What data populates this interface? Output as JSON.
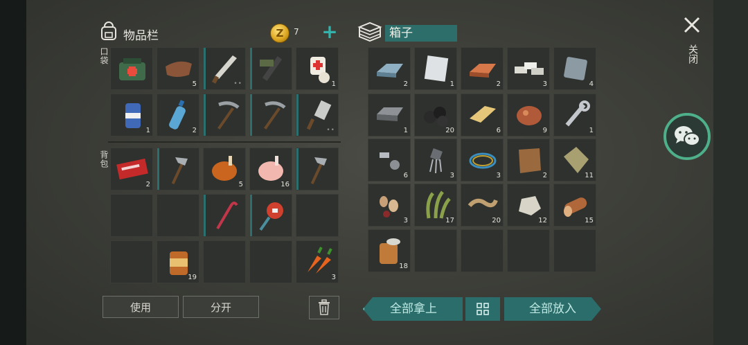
{
  "inventory": {
    "title": "物品栏",
    "coins": "7",
    "coin_symbol": "Z",
    "pocket_label": "口袋",
    "backpack_label": "背包",
    "pocket_slots": [
      {
        "icon": "first-aid-bag-icon",
        "count": ""
      },
      {
        "icon": "leather-icon",
        "count": "5"
      },
      {
        "icon": "machete-icon",
        "count": "",
        "durability": "••"
      },
      {
        "icon": "crossbow-icon",
        "count": ""
      },
      {
        "icon": "bandage-icon",
        "count": "1"
      },
      {
        "icon": "beer-can-icon",
        "count": "1"
      },
      {
        "icon": "water-bottle-icon",
        "count": "2"
      },
      {
        "icon": "pickaxe-icon",
        "count": ""
      },
      {
        "icon": "pickaxe-icon",
        "count": ""
      },
      {
        "icon": "cleaver-icon",
        "count": "",
        "durability": "••"
      }
    ],
    "backpack_slots": [
      {
        "icon": "coupon-icon",
        "count": "2"
      },
      {
        "icon": "hatchet-icon",
        "count": ""
      },
      {
        "icon": "roast-chicken-icon",
        "count": "5"
      },
      {
        "icon": "raw-chicken-icon",
        "count": "16"
      },
      {
        "icon": "hatchet-icon",
        "count": ""
      },
      {
        "icon": "",
        "count": ""
      },
      {
        "icon": "",
        "count": ""
      },
      {
        "icon": "crowbar-icon",
        "count": ""
      },
      {
        "icon": "stop-sign-icon",
        "count": ""
      },
      {
        "icon": "",
        "count": ""
      },
      {
        "icon": "",
        "count": ""
      },
      {
        "icon": "canned-food-icon",
        "count": "19"
      },
      {
        "icon": "",
        "count": ""
      },
      {
        "icon": "",
        "count": ""
      },
      {
        "icon": "carrot-icon",
        "count": "3"
      }
    ],
    "use_label": "使用",
    "split_label": "分开"
  },
  "box": {
    "title": "箱子",
    "slots": [
      {
        "icon": "iron-ingot-icon",
        "count": "2"
      },
      {
        "icon": "aluminum-sheet-icon",
        "count": "1"
      },
      {
        "icon": "copper-ingot-icon",
        "count": "2"
      },
      {
        "icon": "silver-bars-icon",
        "count": "3"
      },
      {
        "icon": "steel-plate-icon",
        "count": "4"
      },
      {
        "icon": "iron-brick-icon",
        "count": "1"
      },
      {
        "icon": "coal-icon",
        "count": "20"
      },
      {
        "icon": "gold-ingot-icon",
        "count": "6"
      },
      {
        "icon": "copper-ore-icon",
        "count": "9"
      },
      {
        "icon": "wrench-icon",
        "count": "1"
      },
      {
        "icon": "bolts-icon",
        "count": "6"
      },
      {
        "icon": "transistor-icon",
        "count": "3"
      },
      {
        "icon": "wire-icon",
        "count": "3"
      },
      {
        "icon": "animal-hide-icon",
        "count": "2"
      },
      {
        "icon": "cloth-icon",
        "count": "11"
      },
      {
        "icon": "seeds-icon",
        "count": "3"
      },
      {
        "icon": "grass-icon",
        "count": "17"
      },
      {
        "icon": "rope-icon",
        "count": "20"
      },
      {
        "icon": "stone-icon",
        "count": "12"
      },
      {
        "icon": "wood-log-icon",
        "count": "15"
      },
      {
        "icon": "open-can-icon",
        "count": "18"
      },
      {
        "icon": "",
        "count": ""
      },
      {
        "icon": "",
        "count": ""
      },
      {
        "icon": "",
        "count": ""
      },
      {
        "icon": "",
        "count": ""
      }
    ],
    "take_all_label": "全部拿上",
    "put_all_label": "全部放入"
  },
  "close_label": "关闭",
  "colors": {
    "accent": "#2c6f6f",
    "teal_button": "#2b6d6a",
    "add": "#34b3ad",
    "chat_ring": "#4eb08a"
  }
}
